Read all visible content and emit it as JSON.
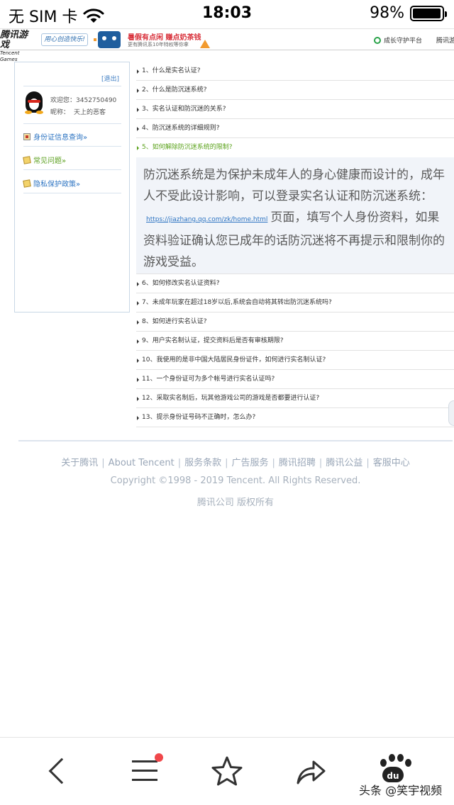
{
  "status_bar": {
    "carrier": "无 SIM 卡",
    "time": "18:03",
    "battery_percent": "98%",
    "battery_level": 0.98,
    "icons": [
      "wifi-icon",
      "battery-icon"
    ]
  },
  "header": {
    "logo_cn": "腾讯游戏",
    "logo_en": "Tencent Games",
    "slogan": "用心创造快乐!",
    "banner_title": "暑假有点闲 赚点奶茶钱",
    "banner_sub": "更有腾讯系10年特权等你拿",
    "growth_platform": "成长守护平台",
    "tencent_games_link": "腾讯游"
  },
  "sidebar": {
    "logout": "[退出]",
    "welcome_label": "欢迎您：",
    "user_id": "3452750490",
    "nickname_label": "昵称：",
    "nickname": "天上的恶客",
    "links": [
      {
        "label": "身份证信息查询»",
        "icon": "id-card-icon"
      },
      {
        "label": "常见问题»",
        "icon": "pencil-icon"
      },
      {
        "label": "隐私保护政策»",
        "icon": "pencil-icon"
      }
    ]
  },
  "faq": {
    "items": [
      "1、什么是实名认证?",
      "2、什么是防沉迷系统?",
      "3、实名认证和防沉迷的关系?",
      "4、防沉迷系统的详细规则?",
      "5、如何解除防沉迷系统的限制?",
      "6、如何修改实名认证资料?",
      "7、未成年玩家在超过18岁以后,系统会自动将其转出防沉迷系统吗?",
      "8、如何进行实名认证?",
      "9、用户实名制认证，提交资料后是否有审核期限?",
      "10、我使用的是非中国大陆居民身份证件，如何进行实名制认证?",
      "11、一个身份证可为多个帐号进行实名认证吗?",
      "12、采取实名制后，玩其他游戏公司的游戏是否都要进行认证?",
      "13、提示身份证号码不正确时，怎么办?"
    ],
    "active_index": 4,
    "answer_before": "防沉迷系统是为保护未成年人的身心健康而设计的，成年人不受此设计影响，可以登录实名认证和防沉迷系统：",
    "answer_link": "https://jiazhang.qq.com/zk/home.html",
    "answer_after": "页面，填写个人身份资料，如果资料验证确认您已成年的话防沉迷将不再提示和限制你的游戏受益。"
  },
  "footer": {
    "links": [
      "关于腾讯",
      "About Tencent",
      "服务条款",
      "广告服务",
      "腾讯招聘",
      "腾讯公益",
      "客服中心"
    ],
    "separator": "|",
    "copyright": "Copyright ©1998 - 2019 Tencent. All Rights Reserved.",
    "rights": "腾讯公司 版权所有"
  },
  "toolbar": {
    "buttons": [
      "back-icon",
      "menu-icon",
      "star-icon",
      "share-icon",
      "baidu-paw-icon"
    ],
    "baidu_label": "du",
    "menu_has_notification": true
  },
  "watermark": "头条 @笑宇视频"
}
